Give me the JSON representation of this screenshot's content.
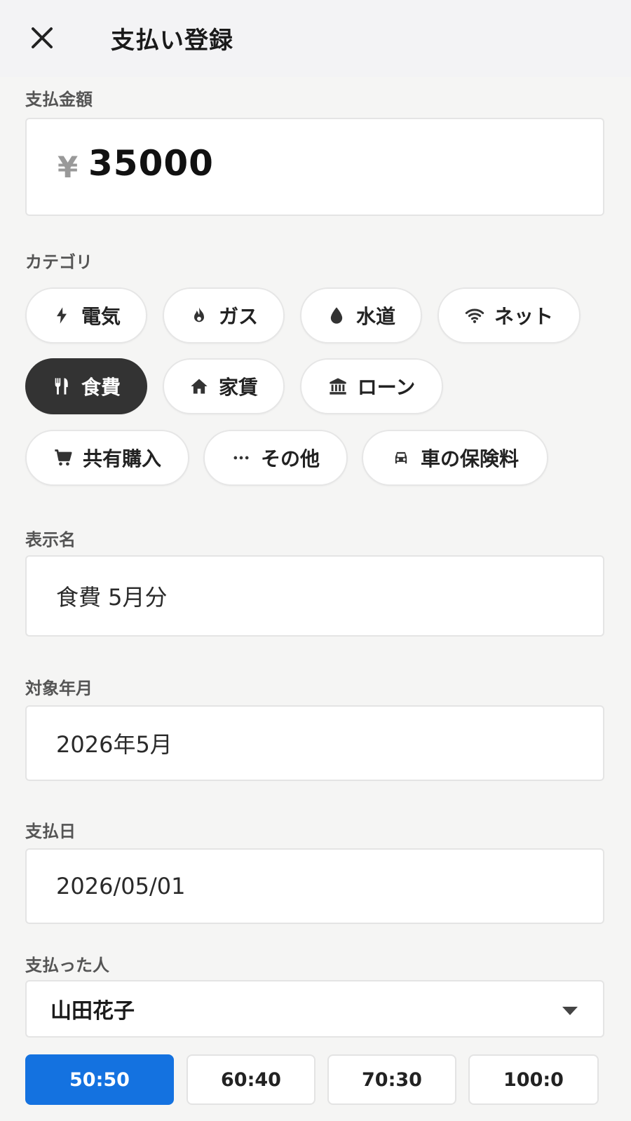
{
  "header": {
    "title": "支払い登録",
    "close_icon": "close-icon"
  },
  "amount": {
    "label": "支払金額",
    "currency": "¥",
    "value": "35000"
  },
  "category": {
    "label": "カテゴリ",
    "selected": "食費",
    "items": [
      {
        "label": "電気",
        "icon": "bolt-icon"
      },
      {
        "label": "ガス",
        "icon": "flame-icon"
      },
      {
        "label": "水道",
        "icon": "water-drop-icon"
      },
      {
        "label": "ネット",
        "icon": "wifi-icon"
      },
      {
        "label": "食費",
        "icon": "fork-knife-icon"
      },
      {
        "label": "家賃",
        "icon": "home-icon"
      },
      {
        "label": "ローン",
        "icon": "bank-icon"
      },
      {
        "label": "共有購入",
        "icon": "cart-icon"
      },
      {
        "label": "その他",
        "icon": "more-dots-icon"
      },
      {
        "label": "車の保険料",
        "icon": "car-icon"
      }
    ]
  },
  "display_name": {
    "label": "表示名",
    "value": "食費 5月分"
  },
  "target_month": {
    "label": "対象年月",
    "value": "2026年5月"
  },
  "payment_date": {
    "label": "支払日",
    "value": "2026/05/01"
  },
  "payer": {
    "label": "支払った人",
    "value": "山田花子"
  },
  "split": {
    "selected": "50:50",
    "options": [
      "50:50",
      "60:40",
      "70:30",
      "100:0"
    ]
  },
  "colors": {
    "accent": "#1472e0",
    "selected_chip": "#333333",
    "background": "#f5f5f4"
  }
}
